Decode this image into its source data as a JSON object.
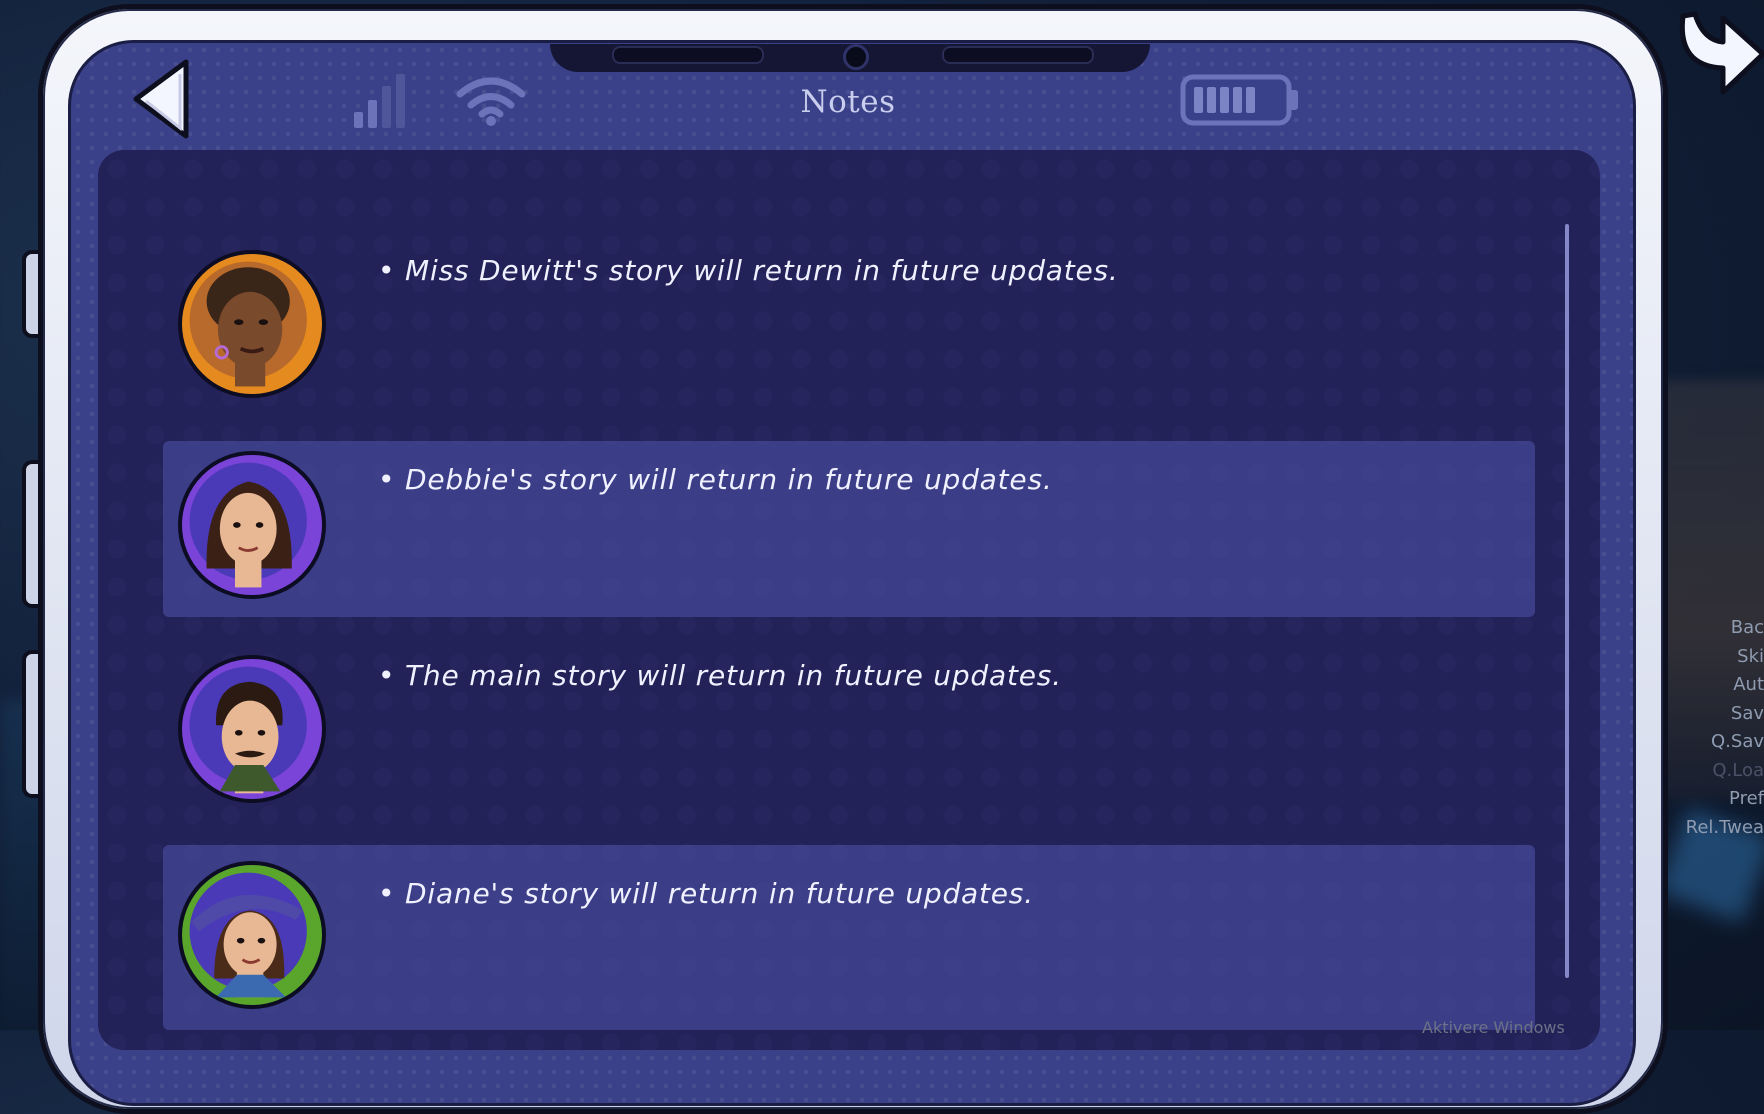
{
  "screen": {
    "title": "Notes"
  },
  "notes": [
    {
      "text": "Miss Dewitt's story will return in future updates.",
      "avatar": "miss-dewitt",
      "ring_color": "#e58a1f"
    },
    {
      "text": "Debbie's story will return in future updates.",
      "avatar": "debbie",
      "ring_color": "#7a44d8"
    },
    {
      "text": "The main story will return in future updates.",
      "avatar": "main-character",
      "ring_color": "#7a44d8"
    },
    {
      "text": "Diane's story will return in future updates.",
      "avatar": "diane",
      "ring_color": "#5aa52b"
    }
  ],
  "quick_menu": [
    "Bac",
    "Ski",
    "Aut",
    "Sav",
    "Q.Sav",
    "Q.Loa",
    "Pref",
    "Rel.Twea"
  ],
  "watermark": "Aktivere Windows",
  "colors": {
    "panel": "#222158",
    "screen": "#3b4189",
    "text": "#f0f1ff",
    "title": "#c9cdee"
  },
  "icons": [
    "back-arrow-icon",
    "signal-icon",
    "wifi-icon",
    "battery-icon",
    "redo-arrow-icon"
  ]
}
